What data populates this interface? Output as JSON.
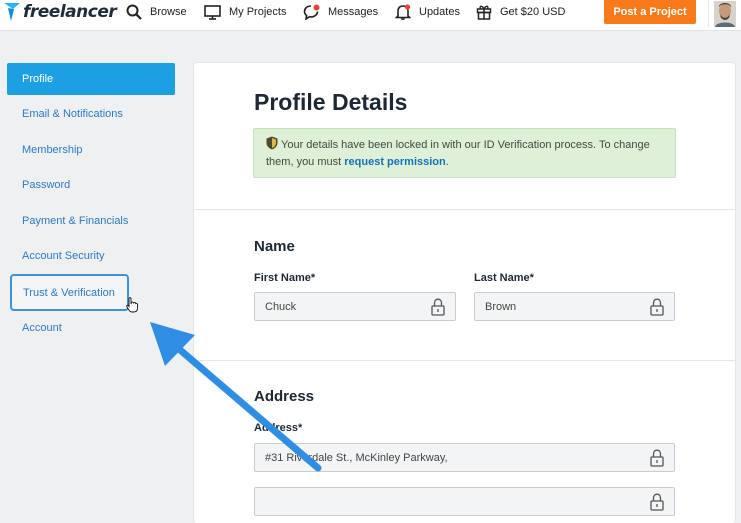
{
  "brand": {
    "name": "freelancer"
  },
  "nav": {
    "browse": "Browse",
    "my_projects": "My Projects",
    "messages": "Messages",
    "updates": "Updates",
    "get_usd": "Get $20 USD",
    "post_project": "Post a Project"
  },
  "sidebar": {
    "items": [
      {
        "label": "Profile"
      },
      {
        "label": "Email & Notifications"
      },
      {
        "label": "Membership"
      },
      {
        "label": "Password"
      },
      {
        "label": "Payment & Financials"
      },
      {
        "label": "Account Security"
      },
      {
        "label": "Trust & Verification"
      },
      {
        "label": "Account"
      }
    ]
  },
  "main": {
    "title": "Profile Details",
    "notice": {
      "text_before": "Your details have been locked in with our ID Verification process. To change them, you must ",
      "link": "request permission",
      "text_after": "."
    },
    "name_section": {
      "title": "Name",
      "first_name_label": "First Name*",
      "first_name_value": "Chuck",
      "last_name_label": "Last Name*",
      "last_name_value": "Brown"
    },
    "address_section": {
      "title": "Address",
      "address_label": "Address*",
      "address_value": "#31 Riverdale St., McKinley Parkway,",
      "address2_value": ""
    }
  },
  "colors": {
    "accent": "#1d9fe4",
    "post_button": "#f97a1a",
    "notice_bg": "#dff0d8",
    "annotation": "#2f8de4"
  }
}
